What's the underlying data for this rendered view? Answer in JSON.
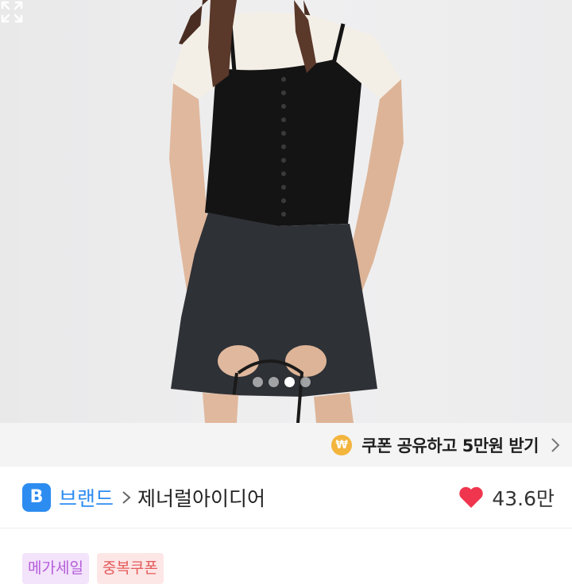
{
  "product_photo": {
    "alt": "",
    "carousel": {
      "total": 4,
      "active_index": 2
    }
  },
  "coupon": {
    "icon_symbol": "₩",
    "text": "쿠폰 공유하고 5만원 받기",
    "accent_color": "#f3b53d"
  },
  "brand": {
    "badge_letter": "B",
    "label": "브랜드",
    "name": "제너럴아이디어",
    "accent_color": "#2d8cf0"
  },
  "like": {
    "count": "43.6만",
    "heart_color": "#f0364f"
  },
  "tags": [
    {
      "label": "메가세일"
    },
    {
      "label": "중복쿠폰"
    }
  ]
}
